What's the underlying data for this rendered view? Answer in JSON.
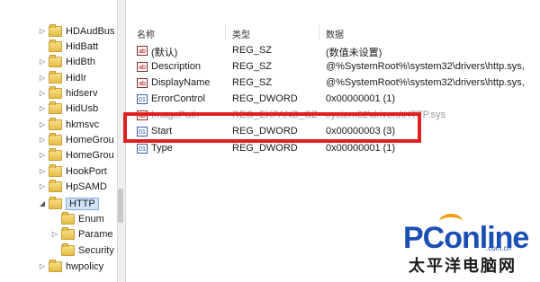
{
  "tree": {
    "items": [
      {
        "label": "HDAudBus",
        "expander": "▷"
      },
      {
        "label": "HidBatt",
        "expander": ""
      },
      {
        "label": "HidBth",
        "expander": "▷"
      },
      {
        "label": "HidIr",
        "expander": "▷"
      },
      {
        "label": "hidserv",
        "expander": "▷"
      },
      {
        "label": "HidUsb",
        "expander": "▷"
      },
      {
        "label": "hkmsvc",
        "expander": "▷"
      },
      {
        "label": "HomeGrou",
        "expander": "▷"
      },
      {
        "label": "HomeGrou",
        "expander": "▷"
      },
      {
        "label": "HookPort",
        "expander": "▷"
      },
      {
        "label": "HpSAMD",
        "expander": "▷"
      },
      {
        "label": "HTTP",
        "expander": "◢",
        "selected": true
      },
      {
        "label": "Enum",
        "expander": "",
        "child": true
      },
      {
        "label": "Parame",
        "expander": "▷",
        "child": true
      },
      {
        "label": "Security",
        "expander": "",
        "child": true
      },
      {
        "label": "hwpolicy",
        "expander": "▷"
      }
    ]
  },
  "columns": {
    "name": "名称",
    "type": "类型",
    "data": "数据"
  },
  "values": [
    {
      "name": "(默认)",
      "type": "REG_SZ",
      "data": "(数值未设置)",
      "icon": "ab"
    },
    {
      "name": "Description",
      "type": "REG_SZ",
      "data": "@%SystemRoot%\\system32\\drivers\\http.sys,",
      "icon": "ab"
    },
    {
      "name": "DisplayName",
      "type": "REG_SZ",
      "data": "@%SystemRoot%\\system32\\drivers\\http.sys,",
      "icon": "ab"
    },
    {
      "name": "ErrorControl",
      "type": "REG_DWORD",
      "data": "0x00000001 (1)",
      "icon": "bin"
    },
    {
      "name": "ImagePath",
      "type": "REG_EXPAND_SZ",
      "data": "system32\\drivers\\HTTP.sys",
      "icon": "ab"
    },
    {
      "name": "Start",
      "type": "REG_DWORD",
      "data": "0x00000003 (3)",
      "icon": "bin"
    },
    {
      "name": "Type",
      "type": "REG_DWORD",
      "data": "0x00000001 (1)",
      "icon": "bin"
    }
  ],
  "watermark": {
    "brand": "PConline",
    "domain": ".com.cn",
    "chinese": "太平洋电脑网"
  },
  "colors": {
    "highlight": "#e02020",
    "brand": "#1a4fb5"
  }
}
